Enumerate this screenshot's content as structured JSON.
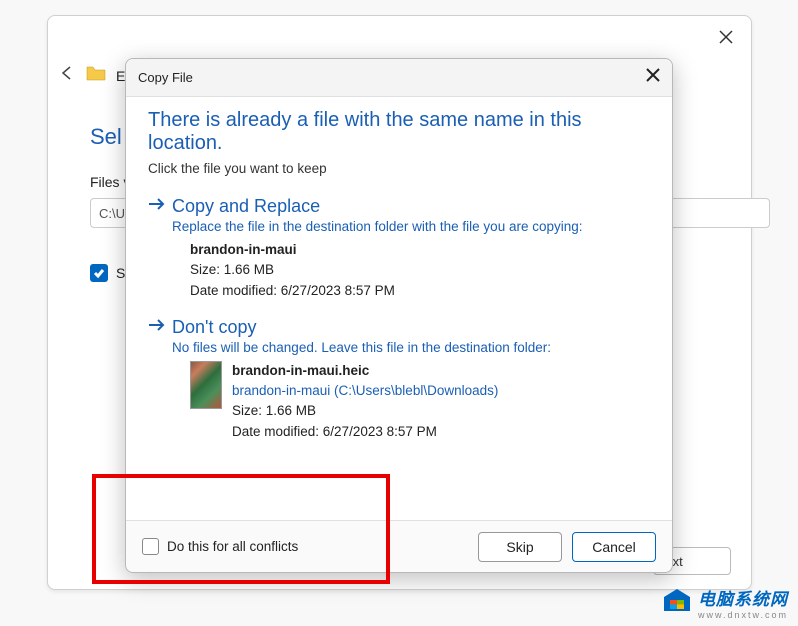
{
  "outer": {
    "back_label": "Ex",
    "sel_label": "Sel",
    "files_label": "Files v",
    "path_value": "C:\\U",
    "sh_label": "Sh",
    "ext_button": "Ext"
  },
  "dialog": {
    "title": "Copy File",
    "headline": "There is already a file with the same name in this location.",
    "subhead": "Click the file you want to keep",
    "option1": {
      "title": "Copy and Replace",
      "desc": "Replace the file in the destination folder with the file you are copying:",
      "filename": "brandon-in-maui",
      "size": "Size: 1.66 MB",
      "date": "Date modified: 6/27/2023 8:57 PM"
    },
    "option2": {
      "title": "Don't copy",
      "desc": "No files will be changed. Leave this file in the destination folder:",
      "filename": "brandon-in-maui.heic",
      "path": "brandon-in-maui (C:\\Users\\blebl\\Downloads)",
      "size": "Size: 1.66 MB",
      "date": "Date modified: 6/27/2023 8:57 PM"
    },
    "all_conflicts": "Do this for all conflicts",
    "skip": "Skip",
    "cancel": "Cancel"
  },
  "watermark": {
    "main": "电脑系统网",
    "sub": "www.dnxtw.com"
  }
}
